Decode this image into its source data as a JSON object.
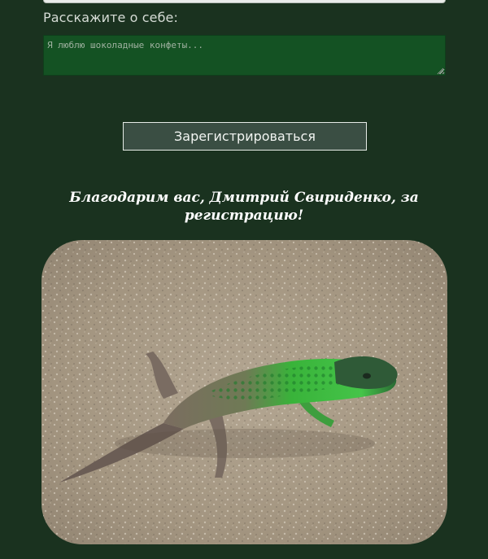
{
  "form": {
    "about_label": "Расскажите о себе:",
    "about_placeholder": "Я люблю шоколадные конфеты...",
    "about_value": "",
    "submit_label": "Зарегистрироваться"
  },
  "result": {
    "message": "Благодарим вас, Дмитрий Свириденко, за регистрацию!"
  },
  "colors": {
    "page_bg": "#1a321f",
    "textarea_bg": "#145223",
    "button_bg": "#3a4e43",
    "text_light": "#d6dcd6"
  },
  "image": {
    "subject": "green-lizard-photo"
  }
}
